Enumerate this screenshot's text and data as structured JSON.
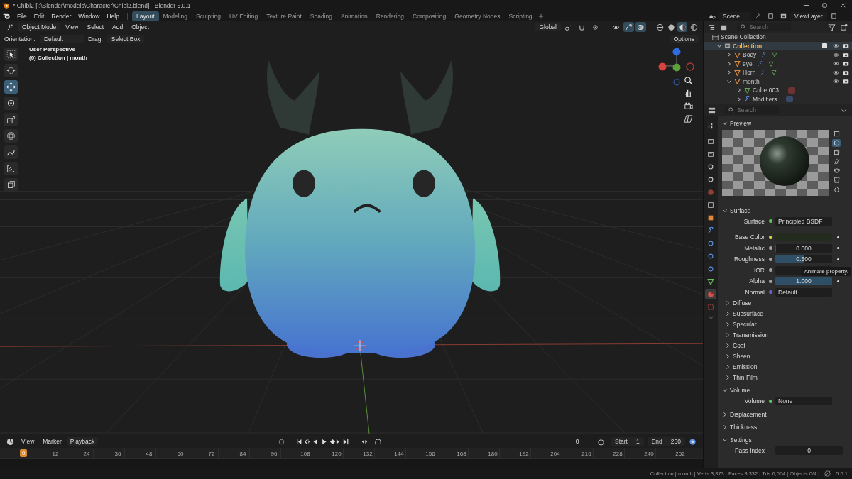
{
  "window": {
    "title": "* Chibi2 [I:\\Blender\\models\\Character\\Chibi2.blend] - Blender 5.0.1"
  },
  "menu": [
    "File",
    "Edit",
    "Render",
    "Window",
    "Help"
  ],
  "workspaces": [
    {
      "label": "Layout",
      "selected": true
    },
    {
      "label": "Modeling",
      "selected": false
    },
    {
      "label": "Sculpting",
      "selected": false
    },
    {
      "label": "UV Editing",
      "selected": false
    },
    {
      "label": "Texture Paint",
      "selected": false
    },
    {
      "label": "Shading",
      "selected": false
    },
    {
      "label": "Animation",
      "selected": false
    },
    {
      "label": "Rendering",
      "selected": false
    },
    {
      "label": "Compositing",
      "selected": false
    },
    {
      "label": "Geometry Nodes",
      "selected": false
    },
    {
      "label": "Scripting",
      "selected": false
    }
  ],
  "scene": "Scene",
  "view_layer": "ViewLayer",
  "viewport": {
    "mode": "Object Mode",
    "menus": [
      "View",
      "Select",
      "Add",
      "Object"
    ],
    "transform": "Global",
    "toggles": [
      {
        "kind": "gizmo",
        "selected": true
      },
      {
        "kind": "overlay",
        "selected": true
      }
    ],
    "shading": [
      {
        "kind": "wireframe",
        "selected": false
      },
      {
        "kind": "solid",
        "selected": false
      },
      {
        "kind": "material",
        "selected": true
      },
      {
        "kind": "rendered",
        "selected": false
      }
    ],
    "orientation_label": "Orientation:",
    "orientation": "Default",
    "drag_label": "Drag:",
    "drag": "Select Box",
    "options": "Options",
    "view_name": "User Perspective",
    "context": "(0) Collection | month",
    "tools": [
      {
        "kind": "select",
        "selected": false
      },
      {
        "kind": "cursor",
        "selected": false
      },
      {
        "kind": "move",
        "selected": true
      },
      {
        "kind": "rotate",
        "selected": false
      },
      {
        "kind": "scale",
        "selected": false
      },
      {
        "kind": "transform",
        "selected": false
      },
      {
        "kind": "annotate",
        "selected": false
      },
      {
        "kind": "measure",
        "selected": false
      },
      {
        "kind": "add_cube",
        "selected": false
      }
    ]
  },
  "outliner": {
    "search_placeholder": "Search",
    "root": "Scene Collection",
    "items": [
      {
        "name": "Collection",
        "kind": "collection",
        "expanded": true,
        "selected": true,
        "checked": true,
        "visible": true,
        "renderable": true,
        "children": [
          {
            "name": "Body",
            "kind": "object",
            "expanded": false,
            "selected": false,
            "visible": true,
            "renderable": true
          },
          {
            "name": "eye",
            "kind": "object",
            "expanded": false,
            "selected": false,
            "visible": true,
            "renderable": true
          },
          {
            "name": "Horn",
            "kind": "object",
            "expanded": false,
            "selected": false,
            "visible": true,
            "renderable": true
          },
          {
            "name": "month",
            "kind": "object",
            "expanded": true,
            "selected": false,
            "visible": true,
            "renderable": true,
            "children": [
              {
                "name": "Cube.003",
                "kind": "mesh",
                "expanded": false,
                "selected": false
              },
              {
                "name": "Modifiers",
                "kind": "modifiers",
                "expanded": false,
                "selected": false
              }
            ]
          }
        ]
      }
    ]
  },
  "properties": {
    "search_placeholder": "Search",
    "tabs": [
      {
        "kind": "tool",
        "selected": false
      },
      {
        "kind": "render",
        "selected": false
      },
      {
        "kind": "output",
        "selected": false
      },
      {
        "kind": "view_layer",
        "selected": false
      },
      {
        "kind": "scene",
        "selected": false
      },
      {
        "kind": "world",
        "selected": false
      },
      {
        "kind": "collection",
        "selected": false
      },
      {
        "kind": "object",
        "selected": false
      },
      {
        "kind": "modifiers",
        "selected": false
      },
      {
        "kind": "particles",
        "selected": false
      },
      {
        "kind": "physics",
        "selected": false
      },
      {
        "kind": "constraints",
        "selected": false
      },
      {
        "kind": "data",
        "selected": false
      },
      {
        "kind": "material",
        "selected": true
      },
      {
        "kind": "texture",
        "selected": false
      }
    ],
    "panels": [
      {
        "title": "Preview",
        "kind": "preview",
        "expanded": true,
        "shapes": [
          {
            "kind": "flat",
            "selected": false
          },
          {
            "kind": "sphere",
            "selected": true
          },
          {
            "kind": "cube",
            "selected": false
          },
          {
            "kind": "hair",
            "selected": false
          },
          {
            "kind": "monkey",
            "selected": false
          },
          {
            "kind": "cloth",
            "selected": false
          },
          {
            "kind": "fluid",
            "selected": false
          }
        ]
      },
      {
        "title": "Surface",
        "kind": "rows",
        "expanded": true,
        "rows": [
          {
            "kind": "link",
            "label": "Surface",
            "color": "#58c75a",
            "value": "Principled BSDF"
          },
          {
            "kind": "color",
            "label": "Base Color",
            "color": "#d8d23a",
            "animatable": true
          },
          {
            "kind": "slider",
            "label": "Metallic",
            "color": "#a3a3a3",
            "value": "0.000",
            "level": 0,
            "animatable": true
          },
          {
            "kind": "slider",
            "label": "Roughness",
            "color": "#a3a3a3",
            "value": "0.500",
            "level": 0.5,
            "animatable": true
          },
          {
            "kind": "slider",
            "label": "IOR",
            "color": "#a3a3a3"
          },
          {
            "kind": "slider",
            "label": "Alpha",
            "color": "#a3a3a3",
            "value": "1.000",
            "level": 1,
            "animatable": true
          },
          {
            "kind": "link",
            "label": "Normal",
            "color": "#6b62c8",
            "value": "Default"
          }
        ],
        "subsections": [
          {
            "label": "Diffuse",
            "expanded": false
          },
          {
            "label": "Subsurface",
            "expanded": false
          },
          {
            "label": "Specular",
            "expanded": false
          },
          {
            "label": "Transmission",
            "expanded": false
          },
          {
            "label": "Coat",
            "expanded": false
          },
          {
            "label": "Sheen",
            "expanded": false
          },
          {
            "label": "Emission",
            "expanded": false
          },
          {
            "label": "Thin Film",
            "expanded": false
          }
        ]
      },
      {
        "title": "Volume",
        "kind": "rows",
        "expanded": true,
        "rows": [
          {
            "kind": "link",
            "label": "Volume",
            "color": "#58c75a",
            "value": "None"
          }
        ]
      },
      {
        "title": "Displacement",
        "kind": "rows",
        "expanded": false
      },
      {
        "title": "Thickness",
        "kind": "rows",
        "expanded": false
      },
      {
        "title": "Settings",
        "kind": "rows",
        "expanded": true,
        "rows": [
          {
            "kind": "number",
            "label": "Pass Index",
            "value": "0"
          }
        ]
      }
    ],
    "tooltip": "Animate property."
  },
  "timeline": {
    "menus": [
      {
        "label": "View",
        "kind": "menu"
      },
      {
        "label": "Marker",
        "kind": "menu"
      },
      {
        "label": "Playback",
        "kind": "dropdown"
      }
    ],
    "current": "0",
    "start_label": "Start",
    "start": "1",
    "end_label": "End",
    "end": "250",
    "playhead": "0",
    "ticks": [
      "12",
      "24",
      "36",
      "48",
      "60",
      "72",
      "84",
      "96",
      "108",
      "120",
      "132",
      "144",
      "156",
      "168",
      "180",
      "192",
      "204",
      "216",
      "228",
      "240",
      "252"
    ]
  },
  "status": {
    "text": "Collection | month | Verts:3,373 | Faces:3,332 | Tris:6,664 | Objects:0/4 |",
    "version": "5.0.1"
  }
}
